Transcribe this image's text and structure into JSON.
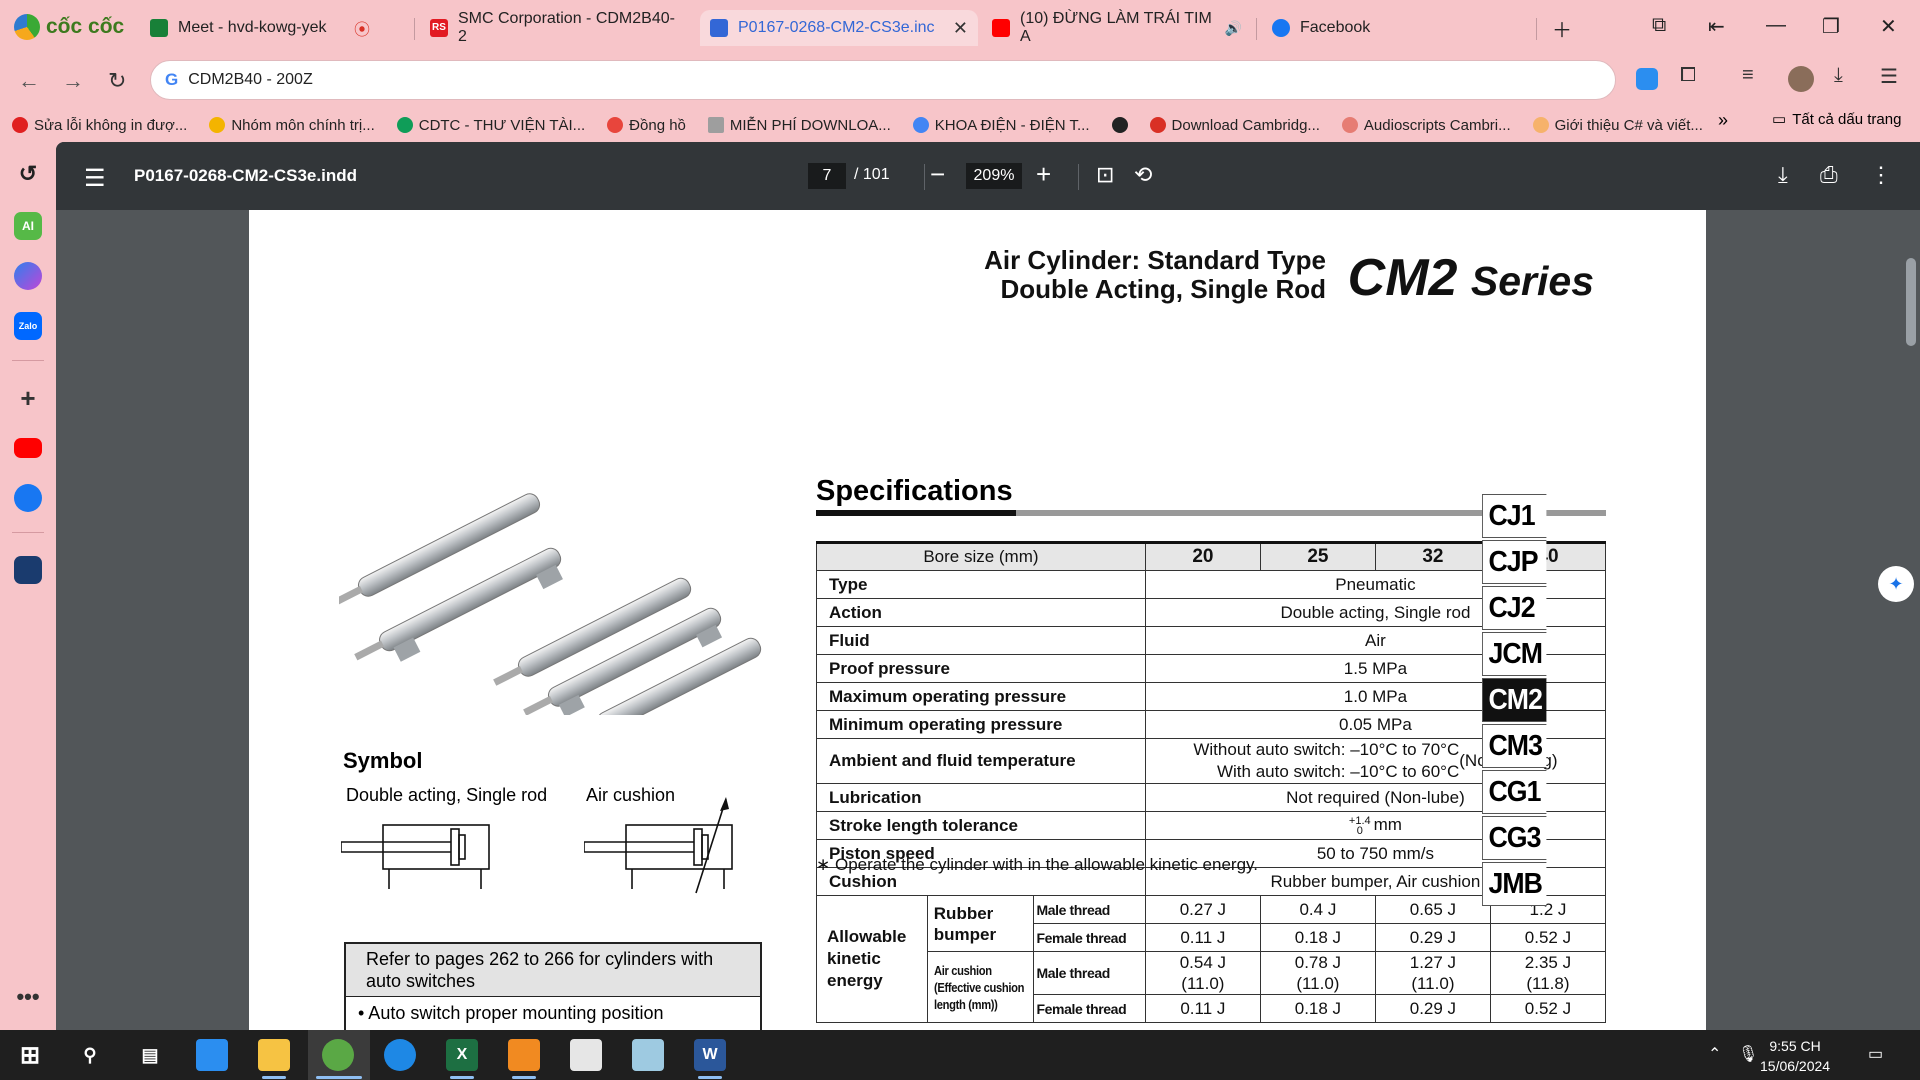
{
  "browser": {
    "brand": "cốc cốc",
    "tabs": [
      {
        "title": "Meet - hvd-kowg-yek",
        "color": "#188038"
      },
      {
        "title": "SMC Corporation - CDM2B40-2",
        "color": "#e21a22"
      },
      {
        "title": "P0167-0268-CM2-CS3e.inc",
        "color": "#3367d6"
      },
      {
        "title": "(10) ĐỪNG LÀM TRÁI TIM A",
        "color": "#ff0000"
      },
      {
        "title": "Facebook",
        "color": "#1877f2"
      }
    ],
    "address": "CDM2B40 - 200Z",
    "bookmarks": [
      {
        "label": "Sửa lỗi không in đượ...",
        "color": "#e02020"
      },
      {
        "label": "Nhóm môn chính trị...",
        "color": "#f4b400"
      },
      {
        "label": "CDTC - THƯ VIỆN TÀI...",
        "color": "#0f9d58"
      },
      {
        "label": "Đồng hồ",
        "color": "#e8453c"
      },
      {
        "label": "MIỄN PHÍ DOWNLOA...",
        "color": "#9e9e9e"
      },
      {
        "label": "KHOA ĐIỆN - ĐIỆN T...",
        "color": "#4285f4"
      },
      {
        "label": "",
        "color": "#222222"
      },
      {
        "label": "Download Cambridg...",
        "color": "#d93025"
      },
      {
        "label": "Audioscripts Cambri...",
        "color": "#e67c73"
      },
      {
        "label": "Giới thiệu C# và viết...",
        "color": "#f6b26b"
      }
    ],
    "all_bookmarks": "Tất cả dấu trang"
  },
  "pdf": {
    "filename": "P0167-0268-CM2-CS3e.indd",
    "page": "7",
    "total_pages": "/ 101",
    "zoom": "209%"
  },
  "doc": {
    "subtitle_line1": "Air Cylinder: Standard Type",
    "subtitle_line2": "Double Acting, Single Rod",
    "series_code": "CM2",
    "series_word": "Series",
    "symbol_title": "Symbol",
    "symbol_label1": "Double acting, Single rod",
    "symbol_label2": "Air cushion",
    "note_head": "Refer to pages 262 to 266 for cylinders with auto switches",
    "note_line": "• Auto switch proper mounting position",
    "spec_title": "Specifications",
    "table": {
      "bore_label": "Bore size (mm)",
      "bores": [
        "20",
        "25",
        "32",
        "40"
      ],
      "rows": [
        {
          "label": "Type",
          "value": "Pneumatic"
        },
        {
          "label": "Action",
          "value": "Double acting, Single rod"
        },
        {
          "label": "Fluid",
          "value": "Air"
        },
        {
          "label": "Proof pressure",
          "value": "1.5 MPa"
        },
        {
          "label": "Maximum operating pressure",
          "value": "1.0 MPa"
        },
        {
          "label": "Minimum operating pressure",
          "value": "0.05 MPa"
        }
      ],
      "temp_label": "Ambient and fluid temperature",
      "temp_line1": "Without auto switch: –10°C to 70°C",
      "temp_line2": "With auto switch: –10°C to 60°C",
      "temp_note": "(No freezing)",
      "lub_label": "Lubrication",
      "lub_value": "Not required (Non-lube)",
      "stroke_label": "Stroke length tolerance",
      "stroke_upper": "+1.4",
      "stroke_lower": "0",
      "stroke_unit": "mm",
      "piston_label": "Piston speed",
      "piston_value": "50 to 750 mm/s",
      "cushion_label": "Cushion",
      "cushion_value": "Rubber bumper, Air cushion",
      "ke_label": "Allowable kinetic energy",
      "rb_label": "Rubber bumper",
      "ac_label": "Air cushion",
      "ac_sub": "(Effective cushion length (mm))",
      "male": "Male thread",
      "female": "Female thread",
      "rb_male": [
        "0.27 J",
        "0.4 J",
        "0.65 J",
        "1.2 J"
      ],
      "rb_female": [
        "0.11 J",
        "0.18 J",
        "0.29 J",
        "0.52 J"
      ],
      "ac_male": [
        "0.54 J",
        "0.78 J",
        "1.27 J",
        "2.35 J"
      ],
      "ac_male_len": [
        "(11.0)",
        "(11.0)",
        "(11.0)",
        "(11.8)"
      ],
      "ac_female": [
        "0.11 J",
        "0.18 J",
        "0.29 J",
        "0.52 J"
      ]
    },
    "footnote": "∗ Operate the cylinder with in the allowable kinetic energy.",
    "series_tabs": [
      "CJ1",
      "CJP",
      "CJ2",
      "JCM",
      "CM2",
      "CM3",
      "CG1",
      "CG3",
      "JMB"
    ],
    "selected_tab": "CM2"
  },
  "taskbar": {
    "time": "9:55 CH",
    "date": "15/06/2024"
  }
}
